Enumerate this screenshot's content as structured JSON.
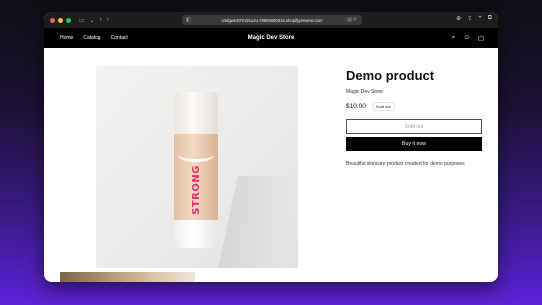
{
  "browser": {
    "url": "o4dgwe3t7rnl2cuzu-79606690316.shopifypreview.com",
    "icons": [
      "sidebar-icon",
      "back-icon",
      "forward-icon",
      "share-icon",
      "new-tab-icon",
      "tabs-icon",
      "download-icon"
    ]
  },
  "store": {
    "nav": [
      "Home",
      "Catalog",
      "Contact"
    ],
    "title": "Magic Dev Store",
    "header_icons": [
      "search-icon",
      "account-icon",
      "cart-icon"
    ]
  },
  "product": {
    "title": "Demo product",
    "vendor": "Magic Dev Store",
    "price": "$10.00",
    "badge": "Sold out",
    "sold_out_label": "Sold out",
    "buy_label": "Buy it now",
    "description": "Beautiful skincare product created for demo purposes",
    "bottle_text": "STRONG"
  },
  "colors": {
    "accent_buy": "#000000",
    "header_bg": "#000000",
    "label_pink": "#e0306a"
  }
}
